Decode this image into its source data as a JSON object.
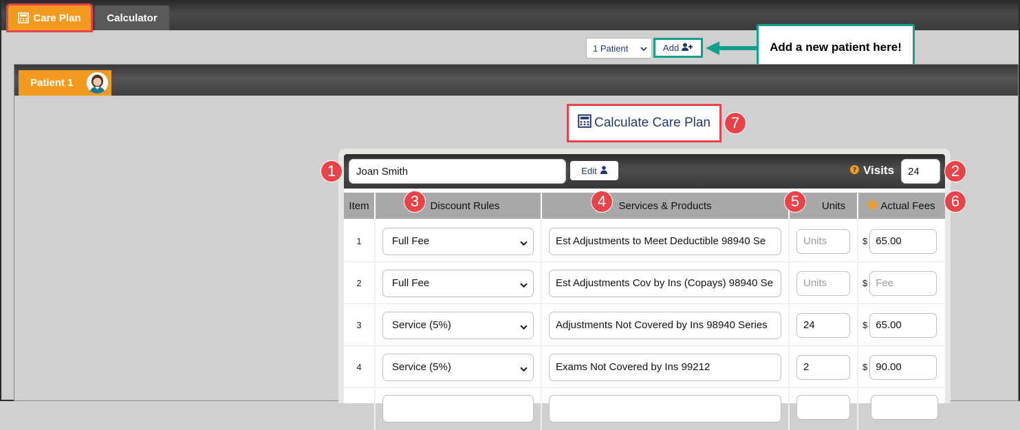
{
  "tabs": [
    {
      "label": "Care Plan",
      "icon": "calculator-icon",
      "active": true
    },
    {
      "label": "Calculator",
      "active": false
    }
  ],
  "patient_select": {
    "value": "1 Patient"
  },
  "add_button": {
    "label": "Add",
    "icon": "add-user-icon"
  },
  "callout": {
    "text": "Add a new patient here!"
  },
  "patient_tab": {
    "label": "Patient 1"
  },
  "calculate_button": {
    "label": "Calculate Care Plan",
    "icon": "calculator-icon"
  },
  "form": {
    "patient_name": "Joan Smith",
    "edit_label": "Edit",
    "visits_label": "Visits",
    "visits_value": "24"
  },
  "table": {
    "headers": [
      "Item",
      "Discount Rules",
      "Services & Products",
      "Units",
      "Actual Fees"
    ],
    "currency_symbol": "$",
    "units_placeholder": "Units",
    "fee_placeholder": "Fee",
    "rows": [
      {
        "item": "1",
        "rule": "Full Fee",
        "service": "Est Adjustments to Meet Deductible 98940 Se",
        "units": "",
        "fee": "65.00"
      },
      {
        "item": "2",
        "rule": "Full Fee",
        "service": "Est Adjustments Cov by Ins (Copays) 98940 Se",
        "units": "",
        "fee": ""
      },
      {
        "item": "3",
        "rule": "Service (5%)",
        "service": "Adjustments Not Covered by Ins 98940 Series",
        "units": "24",
        "fee": "65.00"
      },
      {
        "item": "4",
        "rule": "Service (5%)",
        "service": "Exams Not Covered by Ins 99212",
        "units": "2",
        "fee": "90.00"
      }
    ]
  },
  "badges": [
    "1",
    "2",
    "3",
    "4",
    "5",
    "6",
    "7"
  ],
  "colors": {
    "accent_orange": "#f39a1f",
    "highlight_red": "#e8434a",
    "callout_teal": "#13a08b",
    "navy_text": "#233a6b"
  }
}
